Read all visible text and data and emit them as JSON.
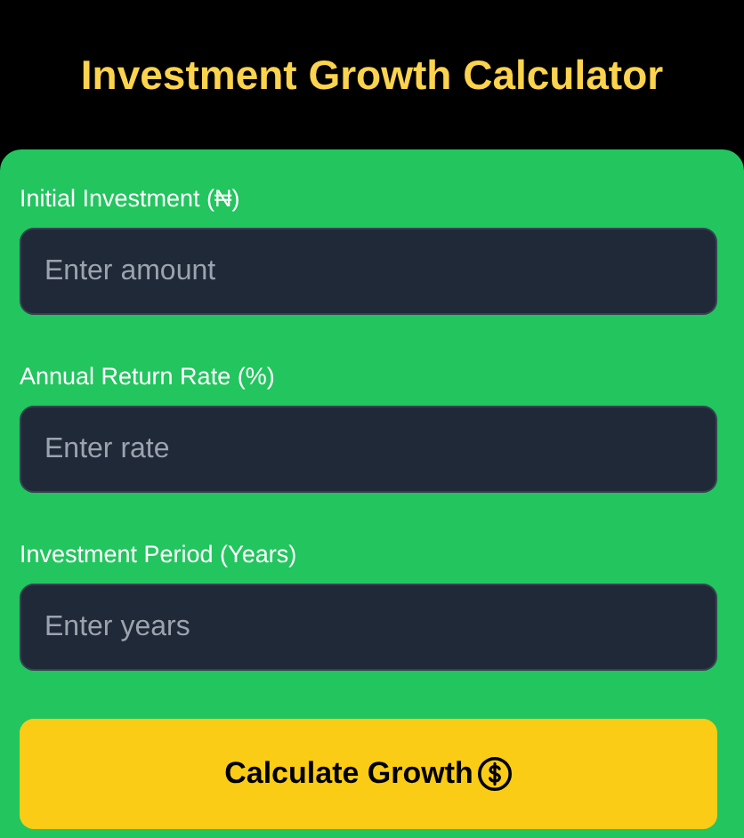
{
  "title": "Investment Growth Calculator",
  "fields": [
    {
      "label": "Initial Investment (₦)",
      "placeholder": "Enter amount"
    },
    {
      "label": "Annual Return Rate (%)",
      "placeholder": "Enter rate"
    },
    {
      "label": "Investment Period (Years)",
      "placeholder": "Enter years"
    }
  ],
  "button": {
    "label": "Calculate Growth"
  }
}
